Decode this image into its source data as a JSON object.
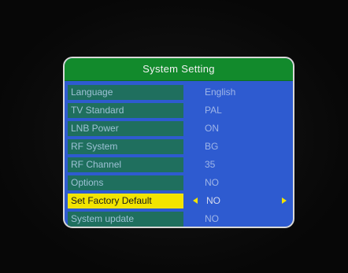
{
  "menu": {
    "title": "System Setting",
    "rows": [
      {
        "label": "Language",
        "value": "English"
      },
      {
        "label": "TV Standard",
        "value": "PAL"
      },
      {
        "label": "LNB Power",
        "value": "ON"
      },
      {
        "label": "RF System",
        "value": "BG"
      },
      {
        "label": "RF Channel",
        "value": "35"
      },
      {
        "label": "Options",
        "value": "NO"
      },
      {
        "label": "Set Factory Default",
        "value": "NO"
      },
      {
        "label": "System update",
        "value": "NO"
      }
    ],
    "selected_row": "Set Factory Default"
  },
  "colors": {
    "title_bar": "#128a2c",
    "panel": "#2e5bd0",
    "label_bg": "#1f6f5e",
    "highlight": "#f2e400"
  },
  "icons": [
    "chevron-left-icon",
    "chevron-right-icon"
  ]
}
